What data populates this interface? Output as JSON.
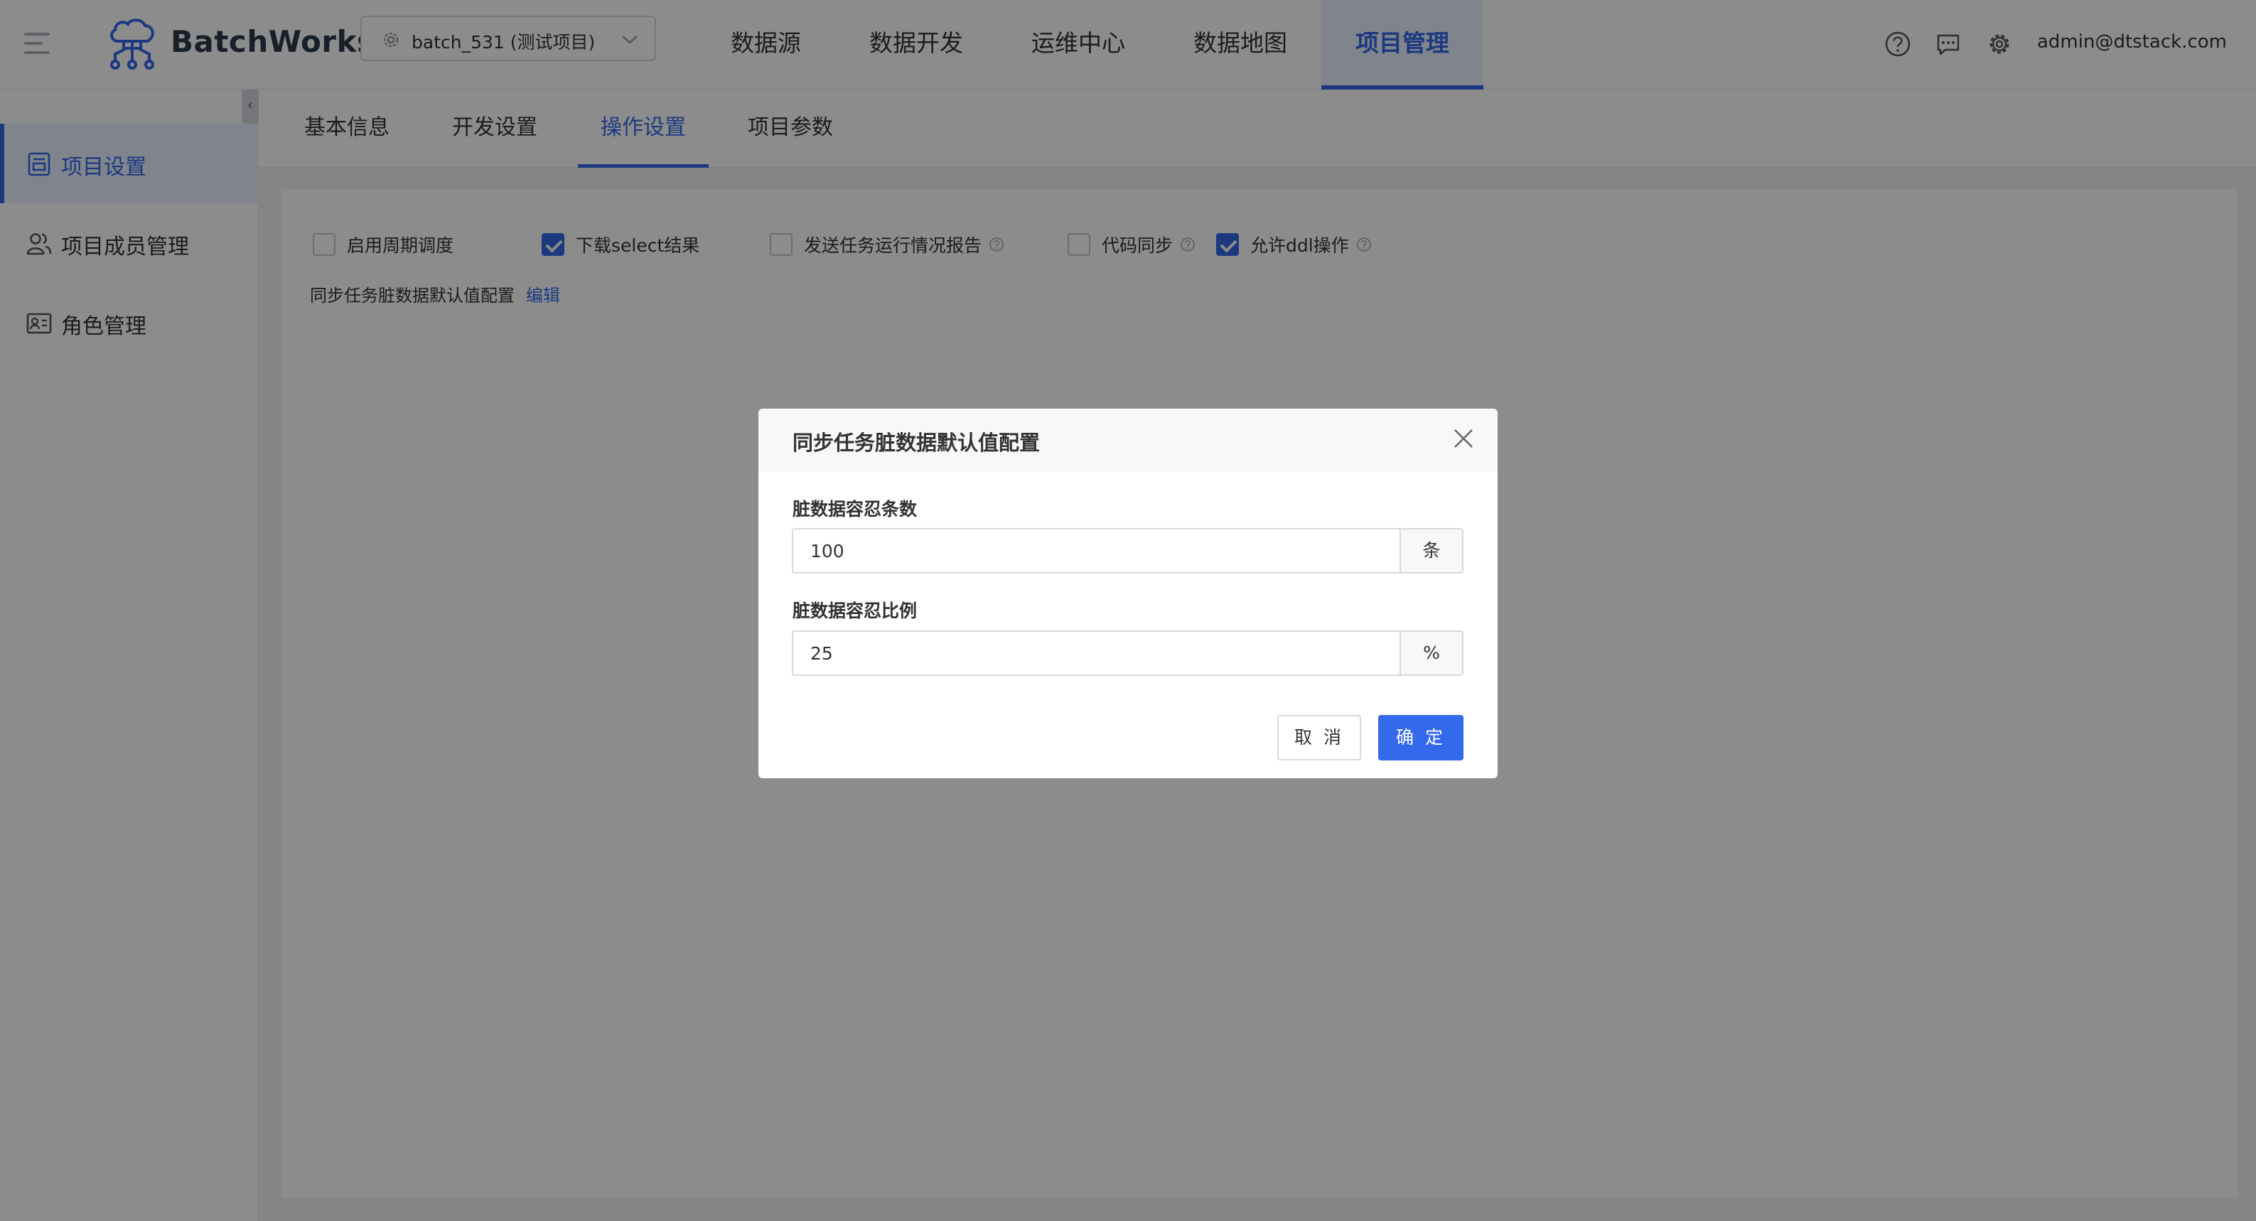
{
  "header": {
    "brand": "BatchWorks",
    "project_selector": "batch_531 (测试项目)",
    "nav": [
      "数据源",
      "数据开发",
      "运维中心",
      "数据地图",
      "项目管理"
    ],
    "active_nav": "项目管理",
    "user_email": "admin@dtstack.com"
  },
  "sidebar": {
    "items": [
      {
        "label": "项目设置",
        "icon": "project-settings-icon",
        "active": true
      },
      {
        "label": "项目成员管理",
        "icon": "members-icon",
        "active": false
      },
      {
        "label": "角色管理",
        "icon": "role-card-icon",
        "active": false
      }
    ]
  },
  "tabs": [
    "基本信息",
    "开发设置",
    "操作设置",
    "项目参数"
  ],
  "active_tab": "操作设置",
  "settings": {
    "checkboxes": [
      {
        "label": "启用周期调度",
        "checked": false,
        "help": false
      },
      {
        "label": "下载select结果",
        "checked": true,
        "help": false
      },
      {
        "label": "发送任务运行情况报告",
        "checked": false,
        "help": true
      },
      {
        "label": "代码同步",
        "checked": false,
        "help": true
      },
      {
        "label": "允许ddl操作",
        "checked": true,
        "help": true
      }
    ],
    "dirty_config_label": "同步任务脏数据默认值配置",
    "edit_link": "编辑"
  },
  "modal": {
    "title": "同步任务脏数据默认值配置",
    "fields": [
      {
        "label": "脏数据容忍条数",
        "value": "100",
        "unit": "条"
      },
      {
        "label": "脏数据容忍比例",
        "value": "25",
        "unit": "%"
      }
    ],
    "cancel": "取 消",
    "ok": "确 定"
  },
  "colors": {
    "accent": "#3369ea",
    "overlay": "rgba(0,0,0,0.45)"
  }
}
